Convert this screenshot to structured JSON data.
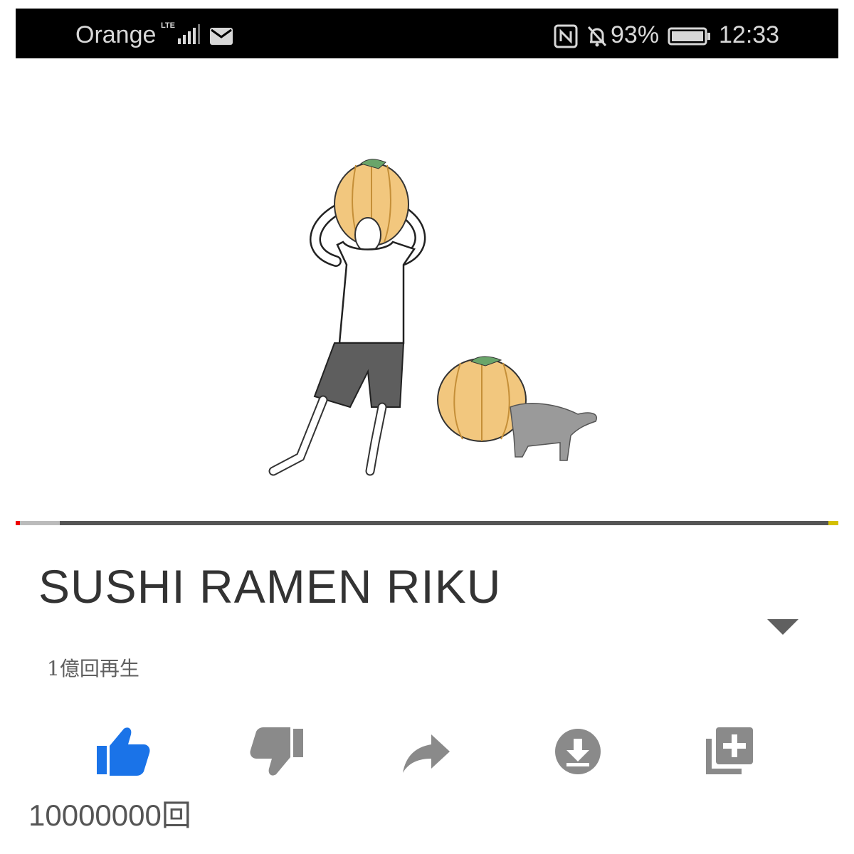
{
  "status_bar": {
    "carrier": "Orange",
    "network": "LTE",
    "battery_percent": "93%",
    "time": "12:33",
    "icons": [
      "signal-icon",
      "mail-icon",
      "nfc-icon",
      "bell-off-icon",
      "battery-icon"
    ]
  },
  "video": {
    "title": "SUSHI RAMEN RIKU",
    "views": "1億回再生",
    "progress": 0.005
  },
  "actions": {
    "like_count": "10000000回",
    "items": [
      "thumbs-up-icon",
      "thumbs-down-icon",
      "share-icon",
      "download-icon",
      "add-to-playlist-icon"
    ]
  },
  "colors": {
    "status_bar_bg": "#000000",
    "like_active": "#1a73e8",
    "icon_gray": "#8a8a8a",
    "progress_played": "#ee0000"
  }
}
